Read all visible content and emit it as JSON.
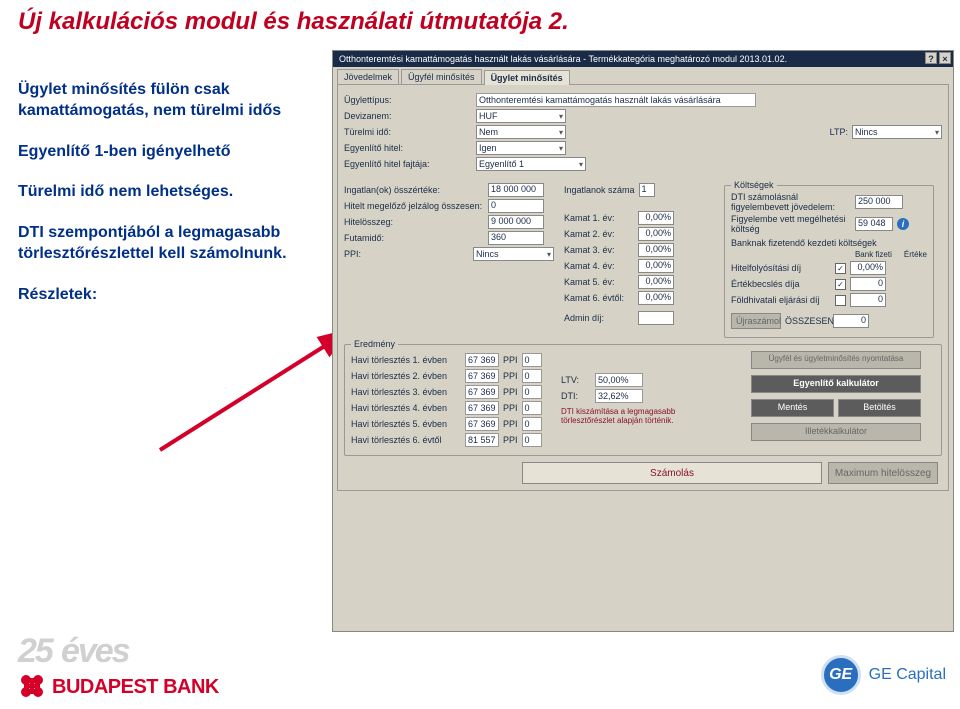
{
  "slide": {
    "title": "Új kalkulációs modul és használati útmutatója 2.",
    "notes": {
      "p1": "Ügylet minősítés fülön csak kamattámogatás, nem türelmi idős",
      "p2": "Egyenlítő 1-ben igényelhető",
      "p3": "Türelmi idő nem lehetséges.",
      "p4": "DTI szempontjából a legmagasabb törlesztőrészlettel kell számolnunk.",
      "p5": "Részletek:"
    }
  },
  "app": {
    "title": "Otthonteremtési kamattámogatás használt lakás vásárlására - Termékkategória meghatározó modul 2013.01.02.",
    "sys": {
      "help": "?",
      "close": "×"
    },
    "tabs": {
      "t1": "Jövedelmek",
      "t2": "Ügyfél minősítés",
      "t3": "Ügylet minősítés"
    },
    "fields": {
      "ugylettipus_lbl": "Ügylettípus:",
      "ugylettipus_val": "Otthonteremtési kamattámogatás használt lakás vásárlására",
      "devizanem_lbl": "Devizanem:",
      "devizanem_val": "HUF",
      "turelmi_lbl": "Türelmi idő:",
      "turelmi_val": "Nem",
      "ltp_lbl": "LTP:",
      "ltp_val": "Nincs",
      "egyenl_hitel_lbl": "Egyenlítő hitel:",
      "egyenl_hitel_val": "Igen",
      "egyenl_fajta_lbl": "Egyenlítő hitel fajtája:",
      "egyenl_fajta_val": "Egyenlítő 1"
    },
    "mid": {
      "ingatlan_lbl": "Ingatlan(ok) összértéke:",
      "ingatlan_val": "18 000 000",
      "ingatlanok_lbl": "Ingatlanok száma",
      "ingatlanok_val": "1",
      "jelzalog_lbl": "Hitelt megelőző jelzálog összesen:",
      "jelzalog_val": "0",
      "hitelosszeg_lbl": "Hitelösszeg:",
      "hitelosszeg_val": "9 000 000",
      "futamido_lbl": "Futamidő:",
      "futamido_val": "360",
      "ppi_lbl": "PPI:",
      "ppi_val": "Nincs"
    },
    "kolt": {
      "title": "Költségek",
      "dti_lbl": "DTI számolásnál figyelembevett jövedelem:",
      "dti_val": "250 000",
      "k1": "Kamat 1. év:",
      "k1v": "0,00%",
      "k2": "Kamat 2. év:",
      "k2v": "0,00%",
      "k3": "Kamat 3. év:",
      "k3v": "0,00%",
      "k4": "Kamat 4. év:",
      "k4v": "0,00%",
      "k5": "Kamat 5. év:",
      "k5v": "0,00%",
      "k6": "Kamat 6. évtől:",
      "k6v": "0,00%",
      "admin_lbl": "Admin díj:",
      "fig_lbl": "Figyelembe vett megélhetési költség",
      "fig_val": "59 048",
      "bank_lbl": "Banknak fizetendő kezdeti költségek",
      "bank_h1": "Bank fizeti",
      "bank_h2": "Értéke",
      "hf_lbl": "Hitelfolyósítási díj",
      "hf_val": "0,00%",
      "eb_lbl": "Értékbecslés díja",
      "eb_val": "0",
      "fe_lbl": "Földhivatali eljárási díj",
      "fe_val": "0",
      "ujra_lbl": "Újraszámol",
      "ossz_lbl": "ÖSSZESEN",
      "ossz_val": "0"
    },
    "eredmeny": {
      "title": "Eredmény",
      "h1": "Havi törlesztés 1. évben",
      "h1v": "67 369",
      "h1p": "0",
      "h2": "Havi törlesztés 2. évben",
      "h2v": "67 369",
      "h2p": "0",
      "h3": "Havi törlesztés 3. évben",
      "h3v": "67 369",
      "h3p": "0",
      "h4": "Havi törlesztés 4. évben",
      "h4v": "67 369",
      "h4p": "0",
      "h5": "Havi törlesztés 5. évben",
      "h5v": "67 369",
      "h5p": "0",
      "h6": "Havi törlesztés 6. évtől",
      "h6v": "81 557",
      "h6p": "0",
      "ppi": "PPI",
      "ltv_lbl": "LTV:",
      "ltv_val": "50,00%",
      "dti_lbl": "DTI:",
      "dti_val": "32,62%",
      "dti_note": "DTI kiszámítása a legmagasabb törlesztőrészlet alapján történik.",
      "btn_print": "Ügyfél és ügyletminősítés nyomtatása",
      "btn_egy": "Egyenlítő kalkulátor",
      "btn_save": "Mentés",
      "btn_load": "Betöltés",
      "btn_illetek": "Illetékkalkulátor"
    },
    "footer": {
      "szamolas": "Számolás",
      "maxhitel": "Maximum hitelösszeg"
    }
  },
  "logos": {
    "bb_25": "25",
    "bb_eves": "éves",
    "bb_name": "BUDAPEST BANK",
    "ge_mono": "GE",
    "ge_text": "GE Capital"
  }
}
